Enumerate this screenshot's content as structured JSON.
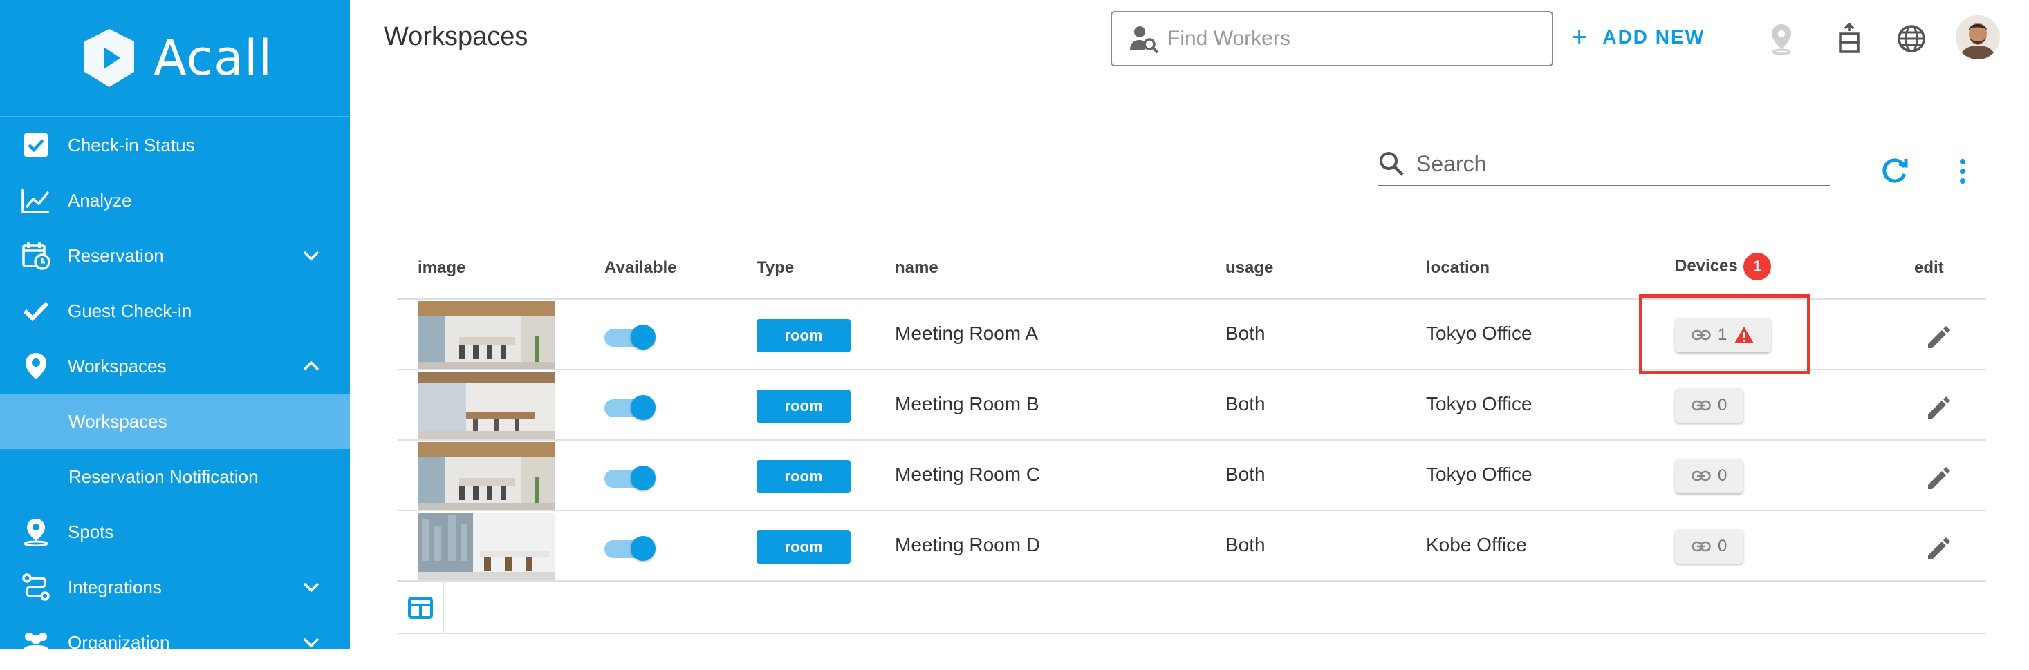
{
  "brand": {
    "name": "Acall"
  },
  "nav": [
    {
      "label": "Check-in Status",
      "icon": "checkbox-icon"
    },
    {
      "label": "Analyze",
      "icon": "chart-line-icon"
    },
    {
      "label": "Reservation",
      "icon": "calendar-clock-icon",
      "expand": "down"
    },
    {
      "label": "Guest Check-in",
      "icon": "check-icon"
    },
    {
      "label": "Workspaces",
      "icon": "location-pin-icon",
      "expand": "up"
    },
    {
      "label": "Workspaces",
      "sub": true,
      "active": true
    },
    {
      "label": "Reservation Notification",
      "sub": true
    },
    {
      "label": "Spots",
      "icon": "location-person-icon"
    },
    {
      "label": "Integrations",
      "icon": "integrations-icon",
      "expand": "down"
    },
    {
      "label": "Organization",
      "icon": "people-icon",
      "expand": "down"
    }
  ],
  "header": {
    "title": "Workspaces",
    "find_placeholder": "Find Workers",
    "add_new_label": "ADD NEW"
  },
  "toolbar": {
    "search_placeholder": "Search"
  },
  "table": {
    "headers": {
      "image": "image",
      "available": "Available",
      "type": "Type",
      "name": "name",
      "usage": "usage",
      "location": "location",
      "devices": "Devices",
      "devices_badge": "1",
      "edit": "edit"
    },
    "rows": [
      {
        "available": true,
        "type": "room",
        "name": "Meeting Room A",
        "usage": "Both",
        "location": "Tokyo Office",
        "devices": "1",
        "warning": true
      },
      {
        "available": true,
        "type": "room",
        "name": "Meeting Room B",
        "usage": "Both",
        "location": "Tokyo Office",
        "devices": "0",
        "warning": false
      },
      {
        "available": true,
        "type": "room",
        "name": "Meeting Room C",
        "usage": "Both",
        "location": "Tokyo Office",
        "devices": "0",
        "warning": false
      },
      {
        "available": true,
        "type": "room",
        "name": "Meeting Room D",
        "usage": "Both",
        "location": "Kobe Office",
        "devices": "0",
        "warning": false
      }
    ]
  },
  "colors": {
    "brand": "#0a9be2",
    "sidebar_active": "#5ab8ee",
    "warning": "#e8392f",
    "badge": "#ef3b34"
  }
}
